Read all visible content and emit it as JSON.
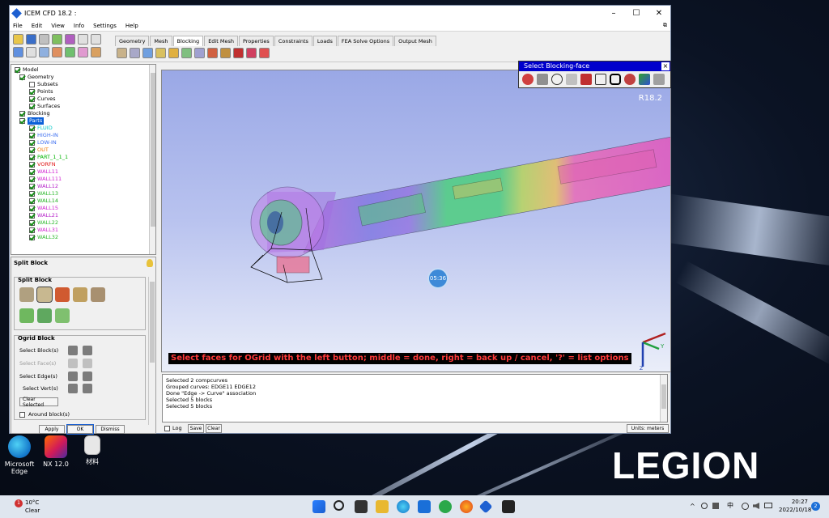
{
  "window": {
    "title": "ICEM CFD 18.2 :",
    "menu": [
      "File",
      "Edit",
      "View",
      "Info",
      "Settings",
      "Help"
    ],
    "tabs": [
      "Geometry",
      "Mesh",
      "Blocking",
      "Edit Mesh",
      "Properties",
      "Constraints",
      "Loads",
      "FEA Solve Options",
      "Output Mesh"
    ],
    "active_tab": "Blocking"
  },
  "tree": {
    "items": [
      {
        "label": "Model",
        "color": "#000000"
      },
      {
        "label": "Geometry",
        "color": "#000000"
      },
      {
        "label": "Subsets",
        "color": "#000000"
      },
      {
        "label": "Points",
        "color": "#000000"
      },
      {
        "label": "Curves",
        "color": "#000000"
      },
      {
        "label": "Surfaces",
        "color": "#000000"
      },
      {
        "label": "Blocking",
        "color": "#000000"
      },
      {
        "label": "Parts",
        "color": "#ffffff"
      },
      {
        "label": "FLUID",
        "color": "#00c8c8"
      },
      {
        "label": "HIGH-IN",
        "color": "#3c6ef0"
      },
      {
        "label": "LOW-IN",
        "color": "#3c6ef0"
      },
      {
        "label": "OUT",
        "color": "#f07800"
      },
      {
        "label": "PART_1_1_1",
        "color": "#00b400"
      },
      {
        "label": "VORFN",
        "color": "#e01414"
      },
      {
        "label": "WALL11",
        "color": "#d01ed0"
      },
      {
        "label": "WALL111",
        "color": "#d01ed0"
      },
      {
        "label": "WALL12",
        "color": "#b41ec8"
      },
      {
        "label": "WALL13",
        "color": "#2cb82c"
      },
      {
        "label": "WALL14",
        "color": "#20b020"
      },
      {
        "label": "WALL15",
        "color": "#d01ed0"
      },
      {
        "label": "WALL21",
        "color": "#b41ec8"
      },
      {
        "label": "WALL22",
        "color": "#2cb82c"
      },
      {
        "label": "WALL31",
        "color": "#d01ed0"
      },
      {
        "label": "WALL32",
        "color": "#2cb82c"
      }
    ]
  },
  "panel": {
    "title": "Split Block",
    "split_block_label": "Split Block",
    "ogrid_label": "Ogrid Block",
    "select_blocks": "Select Block(s)",
    "select_faces": "Select Face(s)",
    "select_edges": "Select Edge(s)",
    "select_verts": "Select Vert(s)",
    "clear_selected": "Clear Selected",
    "around_blocks": "Around block(s)",
    "apply": "Apply",
    "ok": "OK",
    "dismiss": "Dismiss"
  },
  "viewport": {
    "version": "R18.2",
    "status": "Select faces for OGrid with the left button; middle = done, right = back up / cancel, '?' = list options",
    "timer": "05:36",
    "axis_x": "X",
    "axis_y": "Y",
    "axis_z": "Z"
  },
  "select_dialog": {
    "title": "Select Blocking-face"
  },
  "messages": [
    "Selected 2 compcurves",
    "Grouped curves: EDGE11 EDGE12",
    "Done \"Edge -> Curve\" association",
    "Selected 5 blocks",
    "Selected 5 blocks"
  ],
  "bottom": {
    "log": "Log",
    "save": "Save",
    "clear": "Clear",
    "units": "Units: meters"
  },
  "desktop": {
    "brand": "LEGION",
    "icons": [
      "Microsoft Edge",
      "NX 12.0",
      "材料"
    ]
  },
  "taskbar": {
    "weather_temp": "10°C",
    "weather_desc": "Clear",
    "ime": "中",
    "time": "20:27",
    "date": "2022/10/18",
    "notification_count": "2"
  }
}
